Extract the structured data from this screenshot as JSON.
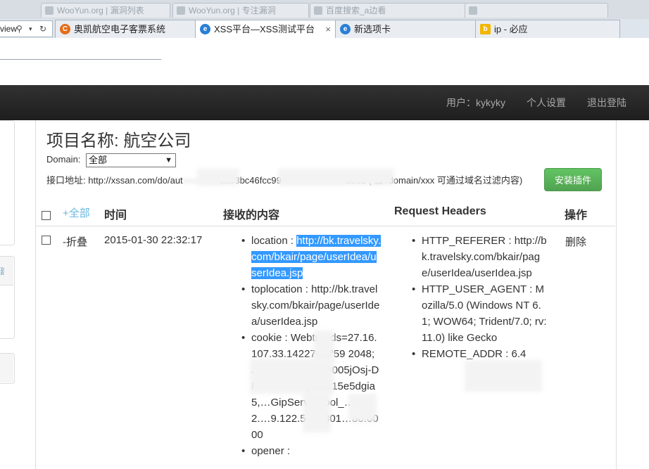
{
  "browser": {
    "faded_tabs": [
      "WooYun.org | 漏洞列表",
      "WooYun.org | 专注漏洞",
      "百度搜索_a边看"
    ],
    "address_fragment": "view",
    "tabs": [
      {
        "label": "奥凯航空电子客票系统",
        "icon": "aokai-icon",
        "active": false
      },
      {
        "label": "XSS平台—XSS测试平台",
        "icon": "ie-icon",
        "active": true,
        "close": "×"
      },
      {
        "label": "新选项卡",
        "icon": "ie-icon",
        "active": false
      },
      {
        "label": "ip - 必应",
        "icon": "bing-icon",
        "active": false
      }
    ]
  },
  "navbar": {
    "user": "用户：kykyky",
    "settings": "个人设置",
    "logout": "退出登陆"
  },
  "left_panels": [
    "",
    "建",
    ""
  ],
  "project": {
    "title": "项目名称: 航空公司",
    "domain_label": "Domain:",
    "domain_value": "全部",
    "api_label": "接口地址:",
    "api_part1": "http://xssan.com/do/aut",
    "api_part2": "8a53bc46fcc99",
    "api_part3": "8801 ( 加 /domain/xxx 可通过域名过滤内容)",
    "install_button": "安装插件"
  },
  "table": {
    "headers": {
      "all": "+全部",
      "time": "时间",
      "content": "接收的内容",
      "headers": "Request Headers",
      "ops": "操作"
    },
    "rows": [
      {
        "toggle": "-折叠",
        "time": "2015-01-30 22:32:17",
        "content": [
          {
            "key": "location",
            "sep": " : ",
            "value": "http://bk.travelsky.com/bkair/page/userIdea/userIdea.jsp",
            "highlighted": true
          },
          {
            "key": "toplocation",
            "sep": " : ",
            "value": "http://bk.travelsky.com/bkair/page/userIdea/userIdea.jsp"
          },
          {
            "key": "cookie",
            "sep": " : ",
            "value": "Webtrends=27.16.107.33.1422704759 2048; JSESSIONID=00005jOsj-DRR…Prr-87yznd:15e5dgia5,…GipServerpool_… 122.…9.122.51=8301…80.0000"
          },
          {
            "key": "opener",
            "sep": " : ",
            "value": ""
          }
        ],
        "headers": [
          {
            "key": "HTTP_REFERER",
            "sep": " : ",
            "value": "http://bk.travelsky.com/bkair/page/userIdea/userIdea.jsp"
          },
          {
            "key": "HTTP_USER_AGENT",
            "sep": " : ",
            "value": "Mozilla/5.0 (Windows NT 6.1; WOW64; Trident/7.0; rv:11.0) like Gecko"
          },
          {
            "key": "REMOTE_ADDR",
            "sep": " : ",
            "value": "6.4"
          }
        ],
        "delete": "删除"
      }
    ]
  }
}
